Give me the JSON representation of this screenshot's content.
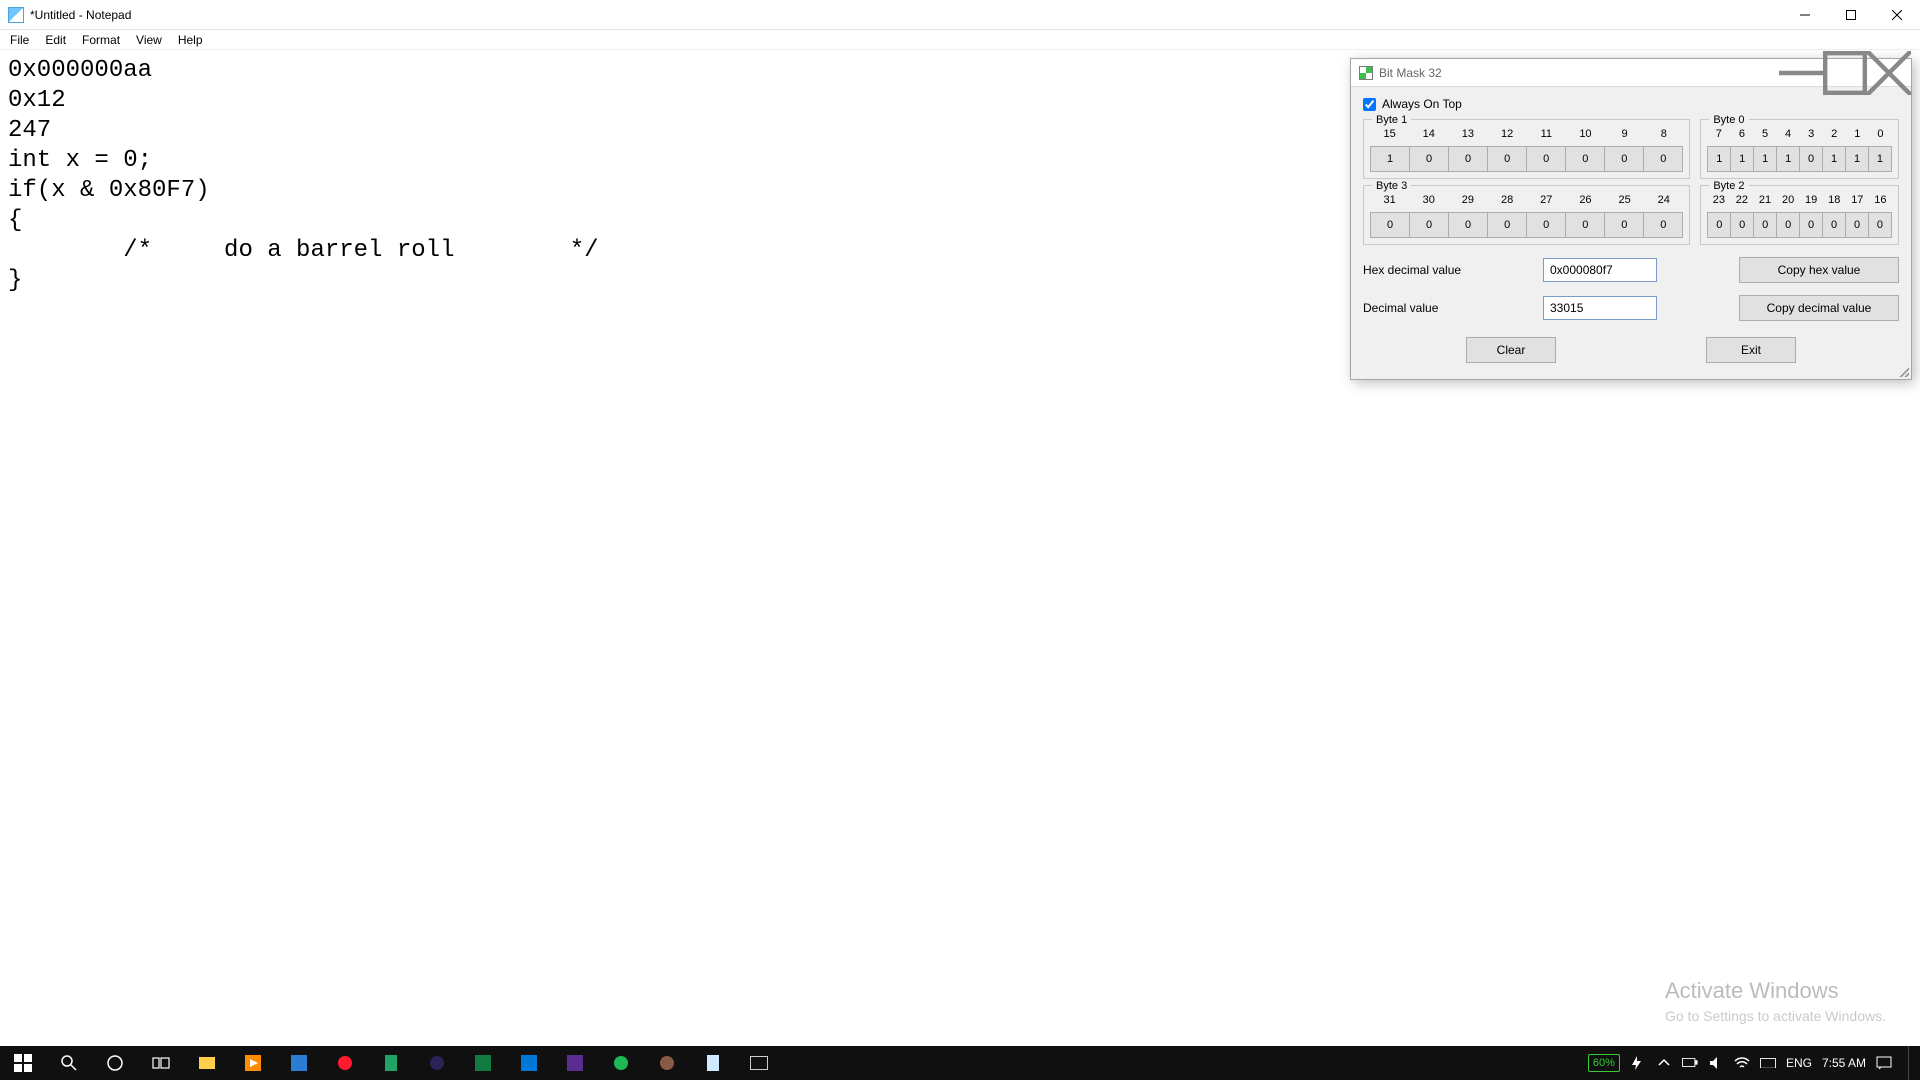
{
  "notepad": {
    "title": "*Untitled - Notepad",
    "menu": [
      "File",
      "Edit",
      "Format",
      "View",
      "Help"
    ],
    "content": "0x000000aa\n0x12\n247\nint x = 0;\nif(x & 0x80F7)\n{\n        /*     do a barrel roll        */\n}"
  },
  "watermark": {
    "line1": "Activate Windows",
    "line2": "Go to Settings to activate Windows."
  },
  "tool": {
    "title": "Bit Mask 32",
    "always_on_top_label": "Always On Top",
    "always_on_top_checked": true,
    "bytes": [
      {
        "title": "Byte 1",
        "labels": [
          "15",
          "14",
          "13",
          "12",
          "11",
          "10",
          "9",
          "8"
        ],
        "bits": [
          "1",
          "0",
          "0",
          "0",
          "0",
          "0",
          "0",
          "0"
        ]
      },
      {
        "title": "Byte 0",
        "labels": [
          "7",
          "6",
          "5",
          "4",
          "3",
          "2",
          "1",
          "0"
        ],
        "bits": [
          "1",
          "1",
          "1",
          "1",
          "0",
          "1",
          "1",
          "1"
        ]
      },
      {
        "title": "Byte 3",
        "labels": [
          "31",
          "30",
          "29",
          "28",
          "27",
          "26",
          "25",
          "24"
        ],
        "bits": [
          "0",
          "0",
          "0",
          "0",
          "0",
          "0",
          "0",
          "0"
        ]
      },
      {
        "title": "Byte 2",
        "labels": [
          "23",
          "22",
          "21",
          "20",
          "19",
          "18",
          "17",
          "16"
        ],
        "bits": [
          "0",
          "0",
          "0",
          "0",
          "0",
          "0",
          "0",
          "0"
        ]
      }
    ],
    "hex_label": "Hex decimal value",
    "hex_value": "0x000080f7",
    "copy_hex": "Copy hex value",
    "dec_label": "Decimal value",
    "dec_value": "33015",
    "copy_dec": "Copy decimal value",
    "clear": "Clear",
    "exit": "Exit"
  },
  "taskbar": {
    "battery": "60%",
    "lang": "ENG",
    "time": "7:55 AM"
  }
}
